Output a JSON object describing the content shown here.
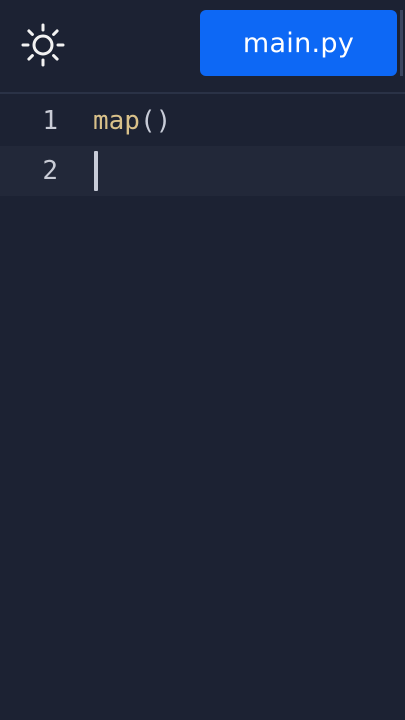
{
  "toolbar": {
    "theme_icon": "sun-icon"
  },
  "tabs": [
    {
      "label": "main.py",
      "active": true
    }
  ],
  "editor": {
    "lines": [
      {
        "number": "1",
        "tokens": {
          "fn": "map",
          "paren": "()"
        }
      },
      {
        "number": "2",
        "tokens": {
          "fn": "",
          "paren": ""
        }
      }
    ],
    "active_line": 2
  },
  "colors": {
    "background": "#1c2233",
    "tab_active": "#0d68f5",
    "function_token": "#d9c18a",
    "punctuation_token": "#c8ccd8",
    "line_number": "#c9ccd6"
  }
}
